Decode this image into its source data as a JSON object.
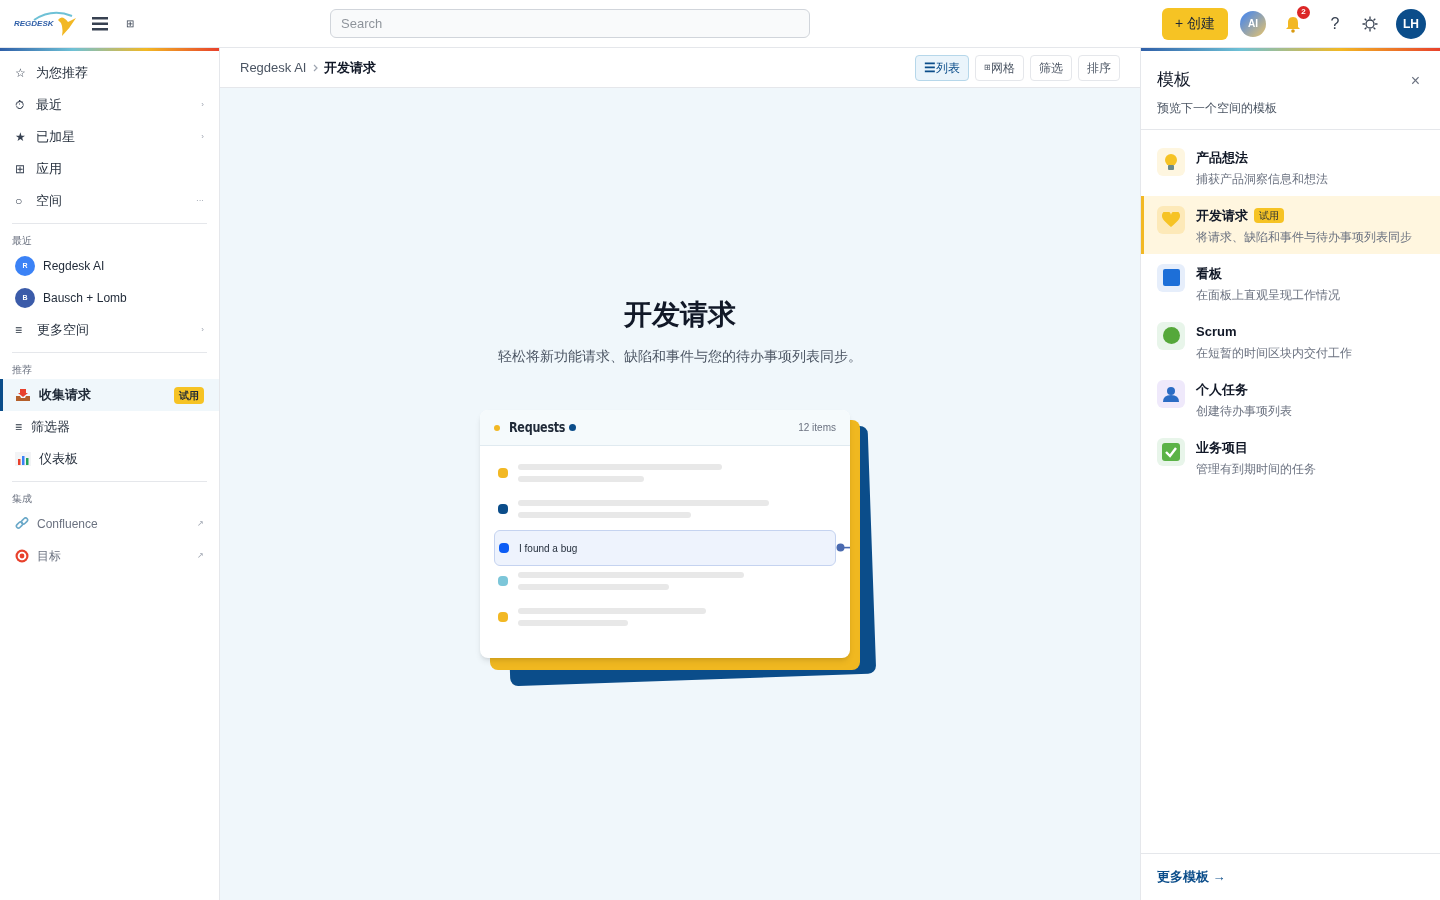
{
  "topbar": {
    "logo": "REGDESK",
    "apps_glyph": "⊞",
    "search": {
      "placeholder": "Search"
    },
    "create_button": "+ 创建",
    "ai_avatar": "AI",
    "notification_count": "2",
    "help": "?",
    "user_avatar": "LH"
  },
  "sidebar": {
    "nav": [
      {
        "icon": "☆",
        "label": "为您推荐"
      },
      {
        "icon": "⏱",
        "label": "最近",
        "trailing": "›"
      },
      {
        "icon": "★",
        "label": "已加星",
        "trailing": "›"
      },
      {
        "icon": "⊞",
        "label": "应用"
      },
      {
        "icon": "○",
        "label": "空间",
        "trailing": "···"
      }
    ],
    "recent": {
      "title": "最近",
      "items": [
        {
          "kind": "space",
          "avatar": "R",
          "label": "Regdesk AI",
          "color": "#3b82f6"
        },
        {
          "kind": "space",
          "avatar": "B",
          "label": "Bausch + Lomb",
          "color": "#3b5ba9"
        },
        {
          "kind": "link",
          "icon": "≡",
          "label": "更多空间",
          "trailing": "›"
        }
      ]
    },
    "recommended": {
      "title": "推荐",
      "items": [
        {
          "kind": "inbox",
          "label": "收集请求",
          "selected": true,
          "badge": "试用"
        },
        {
          "kind": "glyph",
          "icon": "≡",
          "label": "筛选器",
          "selected": false
        },
        {
          "kind": "chart",
          "label": "仪表板",
          "selected": false
        }
      ]
    },
    "integrations": {
      "title": "集成",
      "items": [
        {
          "kind": "link",
          "label": "Confluence",
          "trailing": "↗"
        },
        {
          "kind": "target",
          "label": "目标",
          "trailing": "↗"
        }
      ]
    }
  },
  "main": {
    "breadcrumb": [
      "Regdesk AI",
      "开发请求"
    ],
    "toolbar": [
      {
        "icon": "☰",
        "label": "列表",
        "selected": true
      },
      {
        "icon": "⊞",
        "label": "网格",
        "selected": false
      },
      {
        "label": "筛选",
        "selected": false
      },
      {
        "label": "排序",
        "selected": false
      }
    ],
    "title": "开发请求",
    "subtitle": "轻松将新功能请求、缺陷和事件与您的待办事项列表同步。",
    "illustration": {
      "title": "Requests",
      "count": "12 items",
      "rows": [
        {
          "kind": "placeholder",
          "color": "#f2b824"
        },
        {
          "kind": "placeholder",
          "color": "#0b4d8a"
        },
        {
          "kind": "item",
          "color": "#0b5cf5",
          "text": "I found a bug"
        },
        {
          "kind": "placeholder",
          "color": "#7cc6d9"
        },
        {
          "kind": "placeholder",
          "color": "#f2b824"
        }
      ]
    }
  },
  "templates": {
    "title": "模板",
    "subtitle": "预览下一个空间的模板",
    "close": "×",
    "items": [
      {
        "title": "产品想法",
        "description": "捕获产品洞察信息和想法",
        "selected": false
      },
      {
        "title": "开发请求",
        "description": "将请求、缺陷和事件与待办事项列表同步",
        "selected": true,
        "badge": "试用"
      },
      {
        "title": "看板",
        "description": "在面板上直观呈现工作情况",
        "selected": false
      },
      {
        "title": "Scrum",
        "description": "在短暂的时间区块内交付工作",
        "selected": false
      },
      {
        "title": "个人任务",
        "description": "创建待办事项列表",
        "selected": false
      },
      {
        "title": "业务项目",
        "description": "管理有到期时间的任务",
        "selected": false
      }
    ],
    "more_link": "更多模板 →"
  }
}
